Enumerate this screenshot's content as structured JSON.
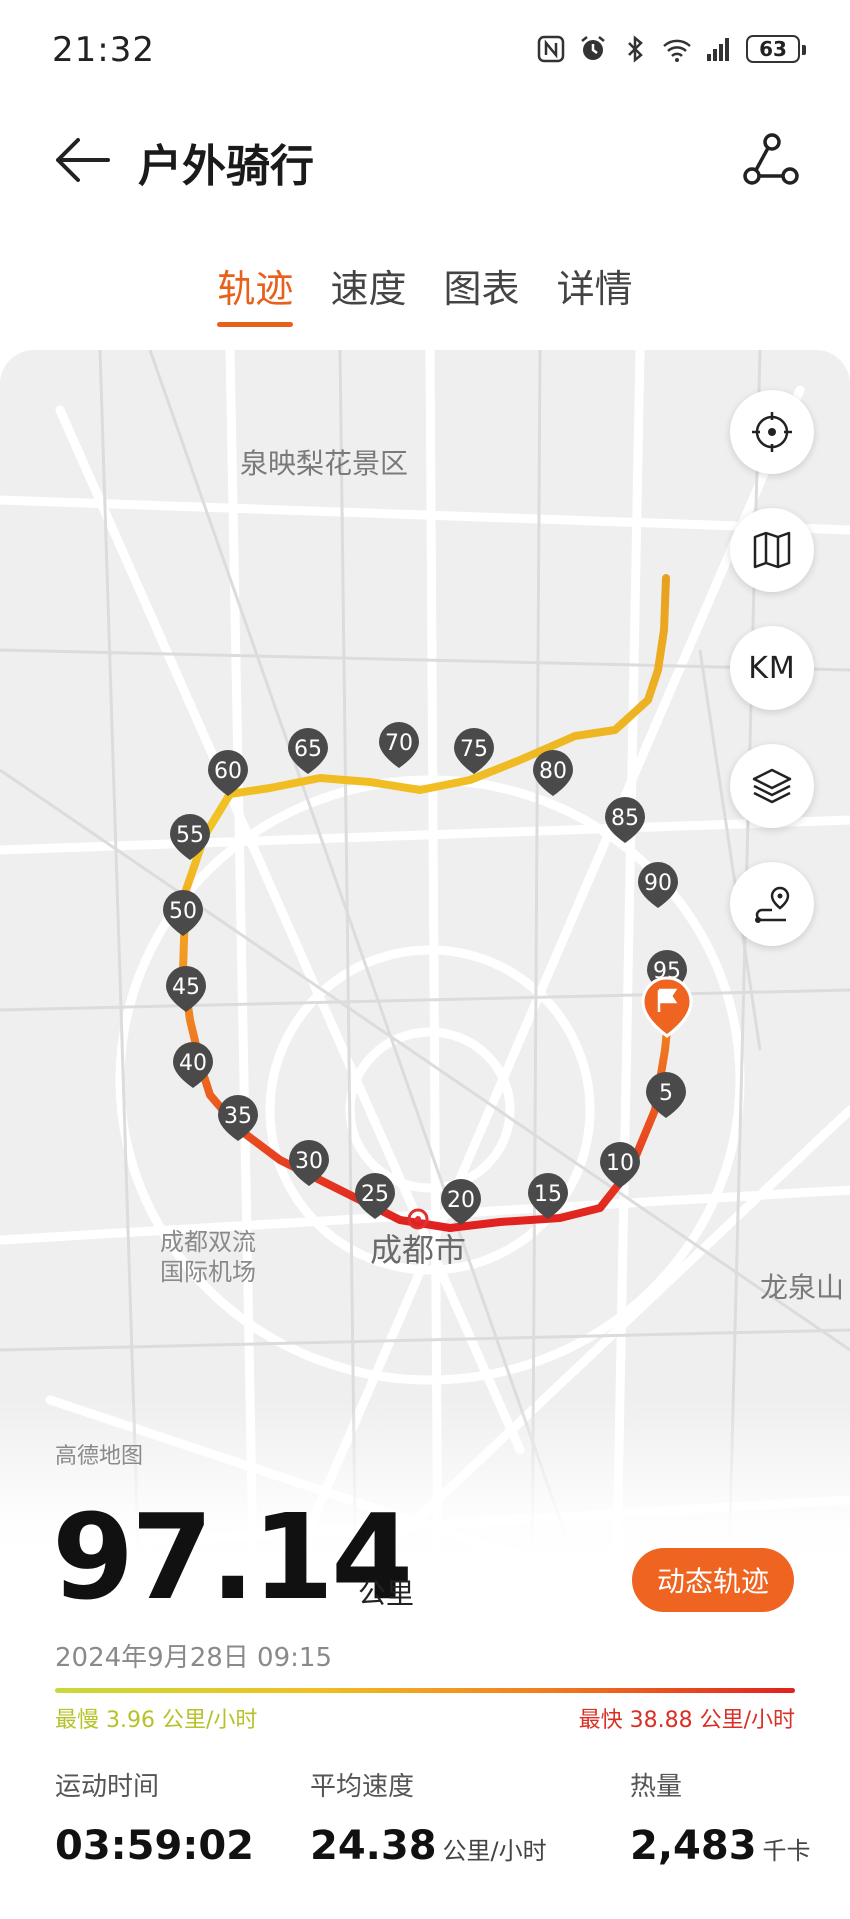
{
  "status": {
    "time": "21:32",
    "battery": "63"
  },
  "header": {
    "title": "户外骑行"
  },
  "tabs": [
    {
      "label": "轨迹",
      "active": true
    },
    {
      "label": "速度",
      "active": false
    },
    {
      "label": "图表",
      "active": false
    },
    {
      "label": "详情",
      "active": false
    }
  ],
  "map": {
    "labels": {
      "scenic": "泉映梨花景区",
      "airport_line1": "成都双流",
      "airport_line2": "国际机场",
      "city": "成都市",
      "longquan": "龙泉山"
    },
    "km_button": "KM",
    "km_markers": [
      "5",
      "10",
      "15",
      "20",
      "25",
      "30",
      "35",
      "40",
      "45",
      "50",
      "55",
      "60",
      "65",
      "70",
      "75",
      "80",
      "85",
      "90",
      "95"
    ],
    "provider": "高德地图"
  },
  "summary": {
    "distance": "97.14",
    "distance_unit": "公里",
    "dynamic_track_button": "动态轨迹",
    "datetime": "2024年9月28日 09:15",
    "slowest": "最慢 3.96 公里/小时",
    "fastest": "最快 38.88 公里/小时"
  },
  "stats": {
    "duration_label": "运动时间",
    "duration_value": "03:59:02",
    "avg_speed_label": "平均速度",
    "avg_speed_value": "24.38",
    "avg_speed_unit": "公里/小时",
    "calories_label": "热量",
    "calories_value": "2,483",
    "calories_unit": "千卡"
  },
  "colors": {
    "accent": "#ee6420",
    "track_slow": "#c8d93a",
    "track_fast": "#e02020"
  }
}
